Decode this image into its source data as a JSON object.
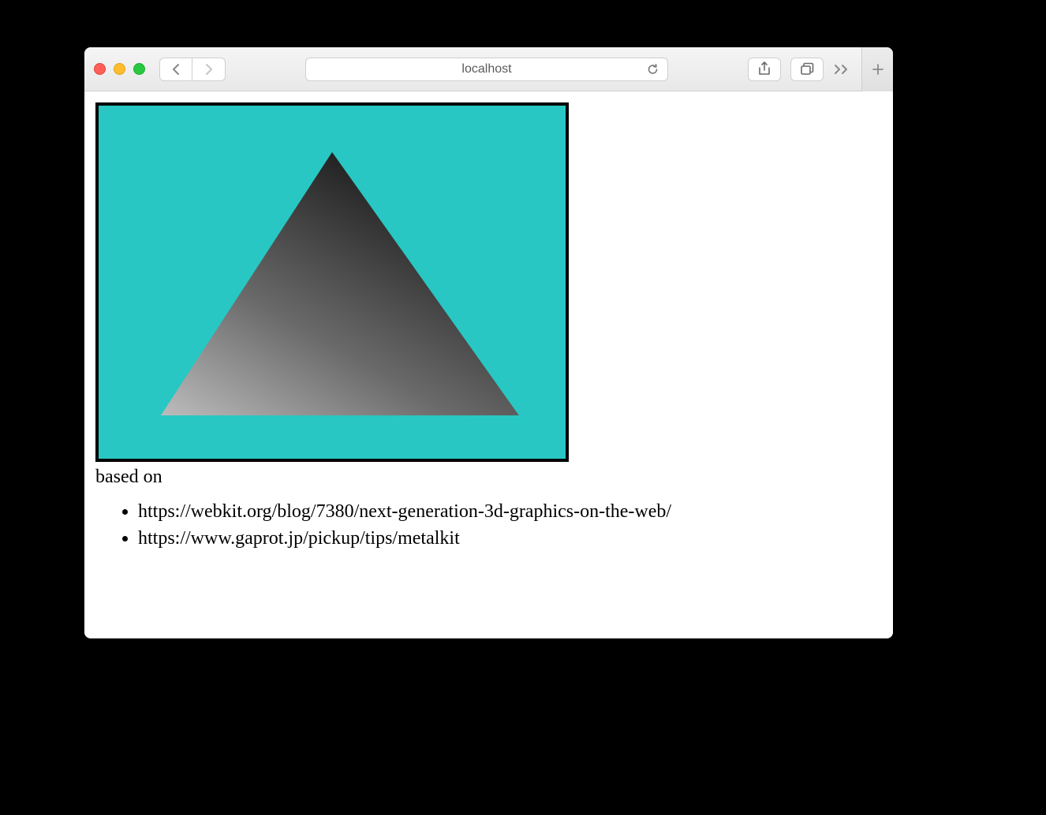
{
  "address_bar": {
    "url_text": "localhost"
  },
  "page": {
    "based_on_label": "based on",
    "references": [
      "https://webkit.org/blog/7380/next-generation-3d-graphics-on-the-web/",
      "https://www.gaprot.jp/pickup/tips/metalkit"
    ]
  },
  "colors": {
    "canvas_bg": "#28c7c3",
    "triangle_gradient_from": "#b8b8b8",
    "triangle_gradient_to": "#222222"
  }
}
